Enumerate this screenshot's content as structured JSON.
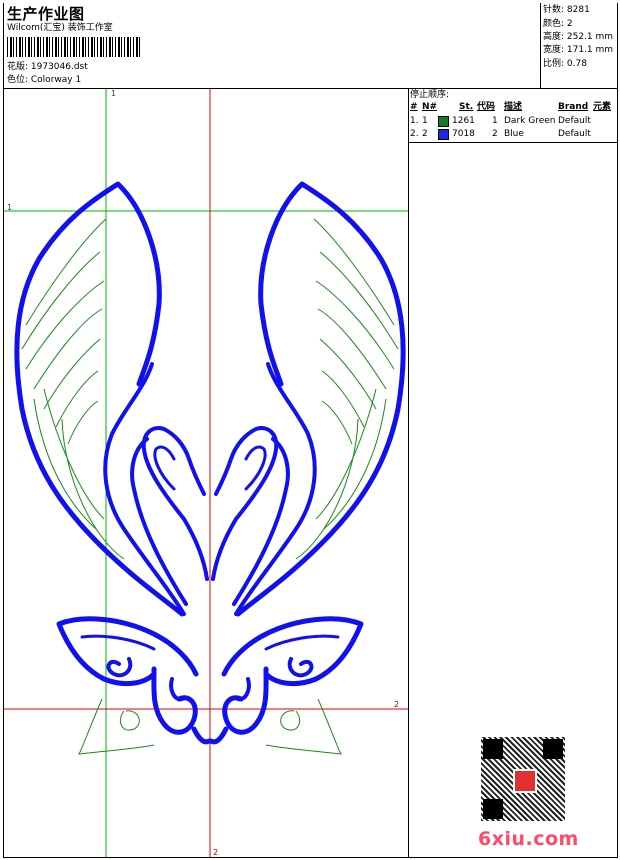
{
  "header": {
    "title": "生产作业图",
    "company": "Wilcom(汇宝) 装饰工作室",
    "design_label": "花版: 1973046.dst",
    "colorway_label": "色位: Colorway 1"
  },
  "stats": {
    "stitches": "针数: 8281",
    "colors": "颜色: 2",
    "height": "高度: 252.1 mm",
    "width": "宽度: 171.1 mm",
    "ratio": "比例: 0.78"
  },
  "stop_sequence": {
    "title": "停止顺序:",
    "headers": [
      "#",
      "N#",
      "St.",
      "代码",
      "描述",
      "Brand",
      "元素"
    ],
    "rows": [
      {
        "index": "1.",
        "n": "1",
        "st": "1261",
        "code": "1",
        "desc": "Dark Green",
        "brand": "Default",
        "color": "#0f7f1f"
      },
      {
        "index": "2.",
        "n": "2",
        "st": "7018",
        "code": "2",
        "desc": "Blue",
        "brand": "Default",
        "color": "#1f24e8"
      }
    ]
  },
  "guides": {
    "green_label_top": "1",
    "green_label_left": "1",
    "red_label_bottom": "2",
    "red_label_right": "2"
  },
  "watermark": "6xiu.com",
  "colors": {
    "guide_green": "#00b000",
    "guide_red": "#e00000",
    "thread_green": "#1a8a1a",
    "thread_blue": "#1010f0",
    "watermark": "#ff4a6a"
  }
}
